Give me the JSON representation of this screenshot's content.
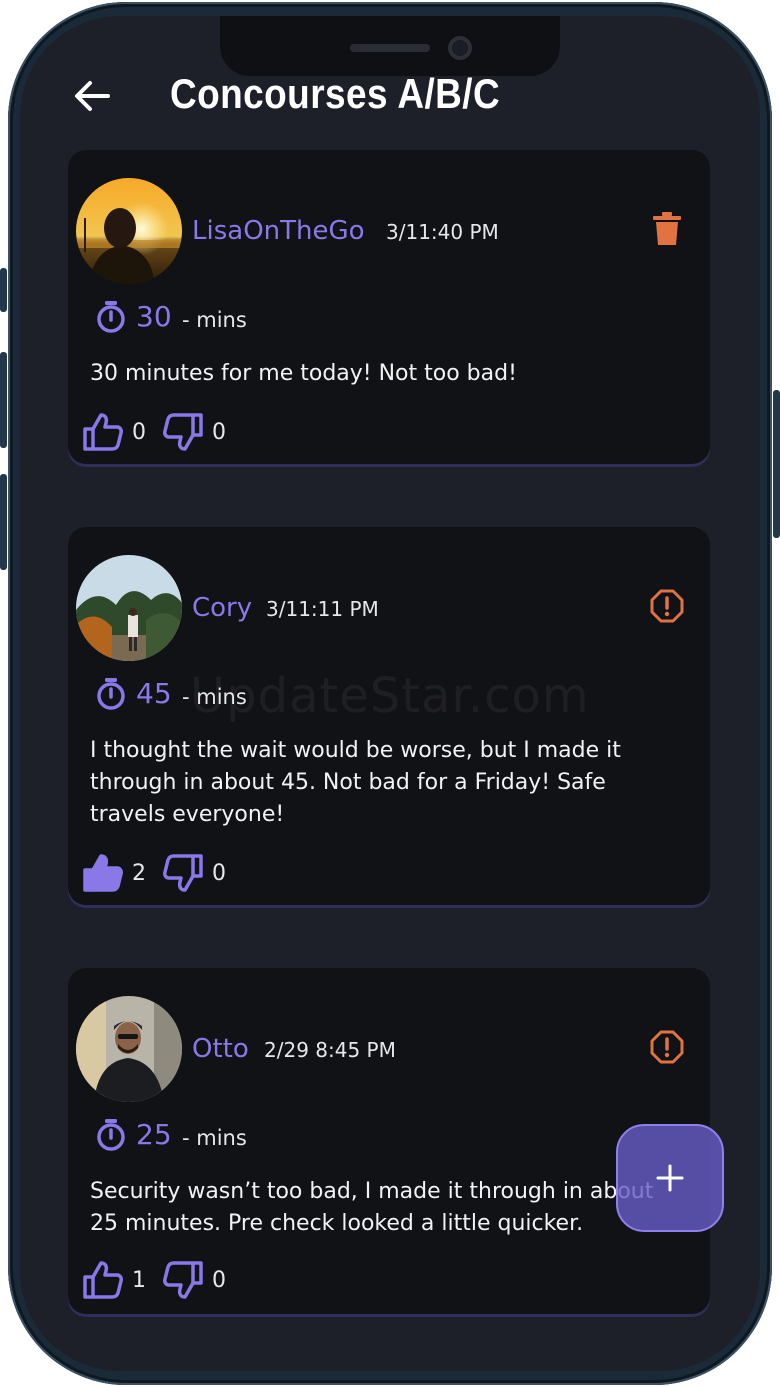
{
  "header": {
    "title": "Concourses A/B/C"
  },
  "posts": [
    {
      "username": "LisaOnTheGo",
      "timestamp": "3/11:40 PM",
      "wait_minutes": "30",
      "unit": "- mins",
      "comment": "30 minutes for me today! Not too bad!",
      "likes": "0",
      "dislikes": "0",
      "action": "trash-icon"
    },
    {
      "username": "Cory",
      "timestamp": "3/11:11 PM",
      "wait_minutes": "45",
      "unit": "- mins",
      "comment": "I thought the wait would be worse, but I made it through in about 45. Not bad for a Friday! Safe travels everyone!",
      "likes": "2",
      "dislikes": "0",
      "action": "report-icon"
    },
    {
      "username": "Otto",
      "timestamp": "2/29 8:45 PM",
      "wait_minutes": "25",
      "unit": "- mins",
      "comment": "Security wasn’t too bad, I made it through in about 25 minutes. Pre check looked a little quicker.",
      "likes": "1",
      "dislikes": "0",
      "action": "report-icon"
    }
  ],
  "watermark": "UpdateStar.com",
  "colors": {
    "accent": "#8a78e8",
    "background": "#1d2029",
    "card": "#111216",
    "action": "#e0733f"
  }
}
